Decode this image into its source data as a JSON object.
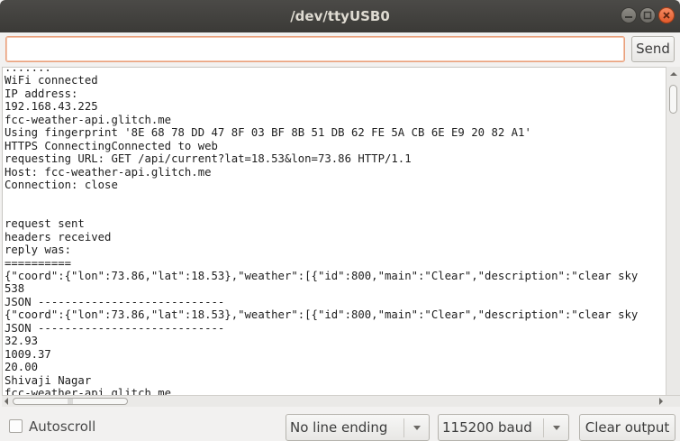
{
  "window": {
    "title": "/dev/ttyUSB0",
    "close_icon": "close-icon",
    "maximize_icon": "maximize-icon",
    "minimize_icon": "minimize-icon"
  },
  "send_bar": {
    "input_value": "",
    "send_label": "Send"
  },
  "serial_output": {
    "lines": [
      ".......",
      "WiFi connected",
      "IP address:",
      "192.168.43.225",
      "fcc-weather-api.glitch.me",
      "Using fingerprint '8E 68 78 DD 47 8F 03 BF 8B 51 DB 62 FE 5A CB 6E E9 20 82 A1'",
      "HTTPS ConnectingConnected to web",
      "requesting URL: GET /api/current?lat=18.53&lon=73.86 HTTP/1.1",
      "Host: fcc-weather-api.glitch.me",
      "Connection: close",
      "",
      "",
      "request sent",
      "headers received",
      "reply was:",
      "==========",
      "{\"coord\":{\"lon\":73.86,\"lat\":18.53},\"weather\":[{\"id\":800,\"main\":\"Clear\",\"description\":\"clear sky",
      "538",
      "JSON ----------------------------",
      "{\"coord\":{\"lon\":73.86,\"lat\":18.53},\"weather\":[{\"id\":800,\"main\":\"Clear\",\"description\":\"clear sky",
      "JSON ----------------------------",
      "32.93",
      "1009.37",
      "20.00",
      "Shivaji Nagar",
      "fcc-weather-api.glitch.me"
    ]
  },
  "footer": {
    "autoscroll_label": "Autoscroll",
    "autoscroll_checked": false,
    "line_ending_value": "No line ending",
    "baud_value": "115200 baud",
    "clear_label": "Clear output"
  }
}
